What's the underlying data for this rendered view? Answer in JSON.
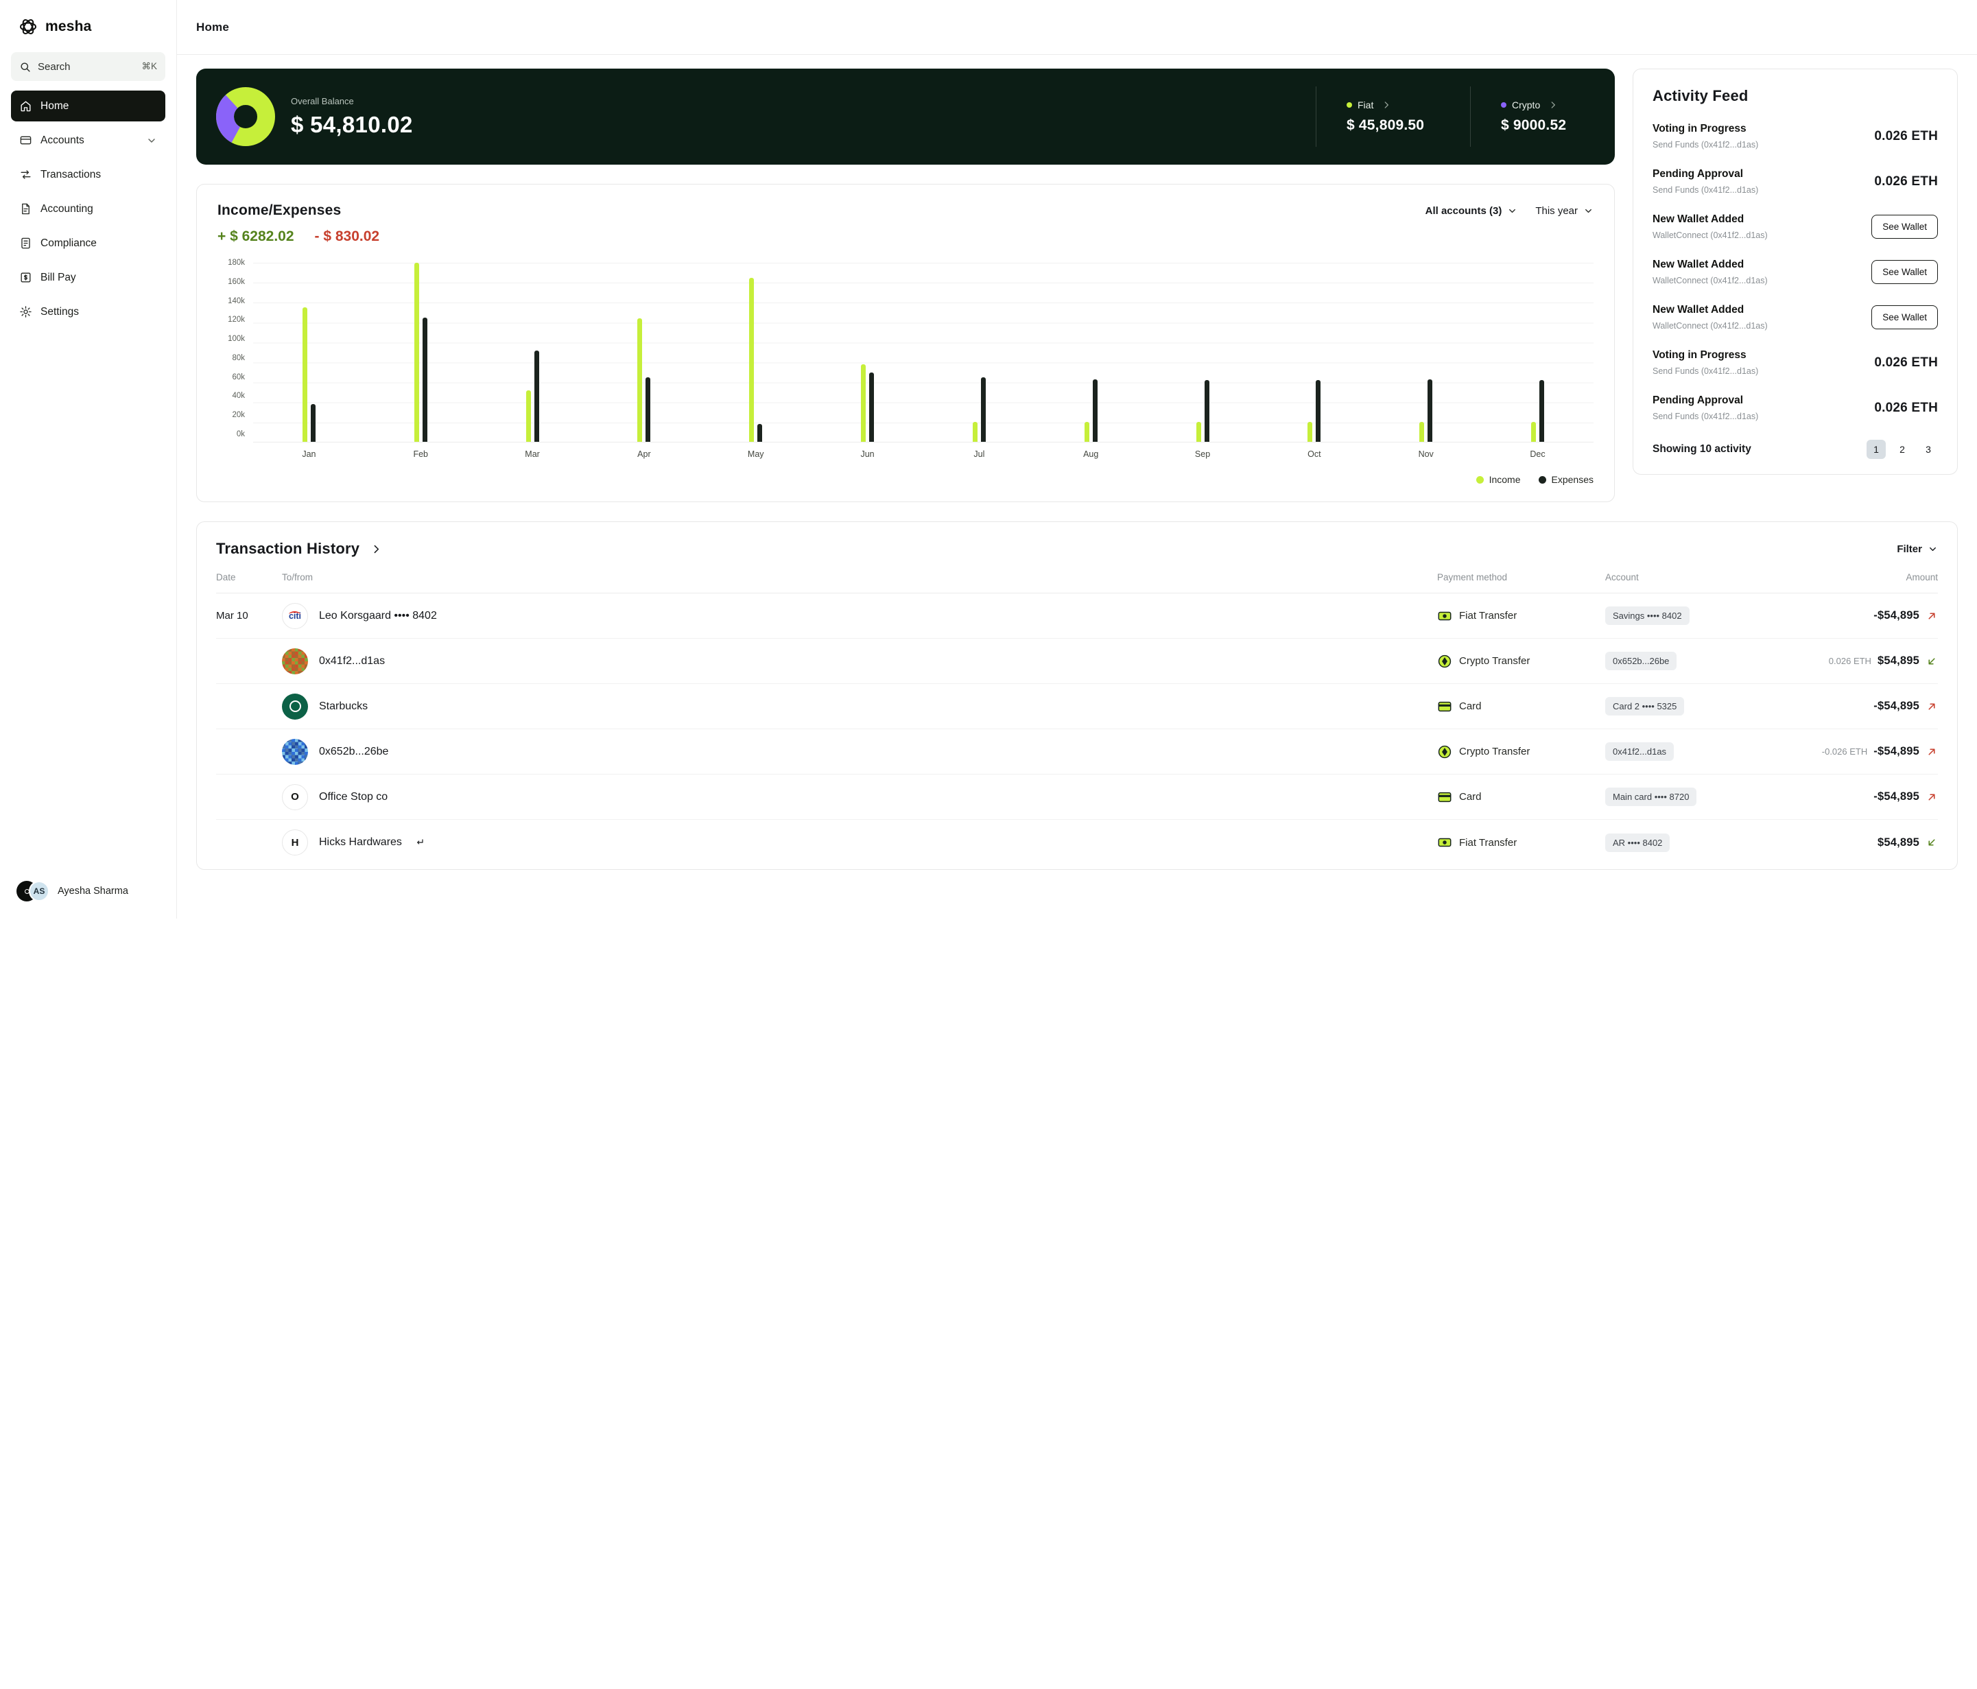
{
  "sidebar": {
    "logo_text": "mesha",
    "search": {
      "label": "Search",
      "shortcut": "⌘K"
    },
    "items": [
      {
        "label": "Home",
        "icon": "home-icon",
        "active": true
      },
      {
        "label": "Accounts",
        "icon": "accounts-icon",
        "chevron": true
      },
      {
        "label": "Transactions",
        "icon": "transactions-icon"
      },
      {
        "label": "Accounting",
        "icon": "accounting-icon"
      },
      {
        "label": "Compliance",
        "icon": "compliance-icon"
      },
      {
        "label": "Bill Pay",
        "icon": "billpay-icon"
      },
      {
        "label": "Settings",
        "icon": "settings-icon"
      }
    ],
    "user": {
      "name": "Ayesha Sharma",
      "initials": "AS"
    }
  },
  "header": {
    "title": "Home"
  },
  "balance": {
    "label": "Overall Balance",
    "amount": "$ 54,810.02",
    "fiat_label": "Fiat",
    "fiat_amount": "$ 45,809.50",
    "crypto_label": "Crypto",
    "crypto_amount": "$ 9000.52"
  },
  "income_expenses": {
    "title": "Income/Expenses",
    "income_total": "+ $ 6282.02",
    "expense_total": "- $ 830.02",
    "accounts_filter": "All accounts (3)",
    "period_filter": "This year",
    "legend": [
      {
        "label": "Income"
      },
      {
        "label": "Expenses"
      }
    ]
  },
  "chart_data": {
    "type": "bar",
    "categories": [
      "Jan",
      "Feb",
      "Mar",
      "Apr",
      "May",
      "Jun",
      "Jul",
      "Aug",
      "Sep",
      "Oct",
      "Nov",
      "Dec"
    ],
    "series": [
      {
        "name": "Income",
        "color": "#c6ef3a",
        "values": [
          135,
          180,
          52,
          124,
          165,
          78,
          20,
          20,
          20,
          20,
          20,
          20
        ]
      },
      {
        "name": "Expenses",
        "color": "#1b231e",
        "values": [
          38,
          125,
          92,
          65,
          18,
          70,
          65,
          63,
          62,
          62,
          63,
          62
        ]
      }
    ],
    "ylabel_ticks": [
      "180k",
      "160k",
      "140k",
      "120k",
      "100k",
      "80k",
      "60k",
      "40k",
      "20k",
      "0k"
    ],
    "ylim": [
      0,
      180
    ],
    "xlabel": "",
    "ylabel": "",
    "title": "Income/Expenses",
    "legend_position": "bottom-right",
    "grid": true
  },
  "activity_feed": {
    "title": "Activity Feed",
    "items": [
      {
        "title": "Voting in Progress",
        "subtitle": "Send Funds  (0x41f2...d1as)",
        "amount": "0.026 ETH"
      },
      {
        "title": "Pending Approval",
        "subtitle": "Send Funds  (0x41f2...d1as)",
        "amount": "0.026 ETH"
      },
      {
        "title": "New Wallet Added",
        "subtitle": "WalletConnect  (0x41f2...d1as)",
        "button": "See Wallet"
      },
      {
        "title": "New Wallet Added",
        "subtitle": "WalletConnect  (0x41f2...d1as)",
        "button": "See Wallet"
      },
      {
        "title": "New Wallet Added",
        "subtitle": "WalletConnect  (0x41f2...d1as)",
        "button": "See Wallet"
      },
      {
        "title": "Voting in Progress",
        "subtitle": "Send Funds  (0x41f2...d1as)",
        "amount": "0.026 ETH"
      },
      {
        "title": "Pending Approval",
        "subtitle": "Send Funds  (0x41f2...d1as)",
        "amount": "0.026 ETH"
      }
    ],
    "footer": "Showing 10 activity",
    "pages": [
      "1",
      "2",
      "3"
    ],
    "active_page": "1"
  },
  "transactions": {
    "title": "Transaction History",
    "filter_label": "Filter",
    "columns": [
      "Date",
      "To/from",
      "Payment method",
      "Account",
      "Amount"
    ],
    "rows": [
      {
        "date": "Mar 10",
        "name": "Leo Korsgaard •••• 8402",
        "avatar": "citi",
        "avatar_text": "citi",
        "method": "Fiat Transfer",
        "method_icon": "fiat",
        "account": "Savings •••• 8402",
        "amount": "-$54,895",
        "direction": "out"
      },
      {
        "date": "",
        "name": "0x41f2...d1as",
        "avatar": "pixel-orange",
        "method": "Crypto Transfer",
        "method_icon": "crypto",
        "account": "0x652b...26be",
        "sub_amount": "0.026 ETH",
        "amount": "$54,895",
        "direction": "in"
      },
      {
        "date": "",
        "name": "Starbucks",
        "avatar": "starbucks",
        "method": "Card",
        "method_icon": "card",
        "account": "Card 2 •••• 5325",
        "amount": "-$54,895",
        "direction": "out"
      },
      {
        "date": "",
        "name": "0x652b...26be",
        "avatar": "pixel-blue",
        "method": "Crypto Transfer",
        "method_icon": "crypto",
        "account": "0x41f2...d1as",
        "sub_amount": "-0.026 ETH",
        "amount": "-$54,895",
        "direction": "out"
      },
      {
        "date": "",
        "name": "Office Stop co",
        "avatar": "letter",
        "avatar_text": "O",
        "method": "Card",
        "method_icon": "card",
        "account": "Main card •••• 8720",
        "amount": "-$54,895",
        "direction": "out"
      },
      {
        "date": "",
        "name": "Hicks Hardwares",
        "avatar": "letter",
        "avatar_text": "H",
        "return_icon": true,
        "method": "Fiat Transfer",
        "method_icon": "fiat",
        "account": "AR •••• 8402",
        "amount": "$54,895",
        "direction": "in"
      }
    ]
  },
  "colors": {
    "accent_green": "#c6ef3a",
    "accent_purple": "#8a63f9",
    "dark_card": "#0c1d15",
    "negative_red": "#c7402e",
    "positive_green": "#55831d"
  }
}
